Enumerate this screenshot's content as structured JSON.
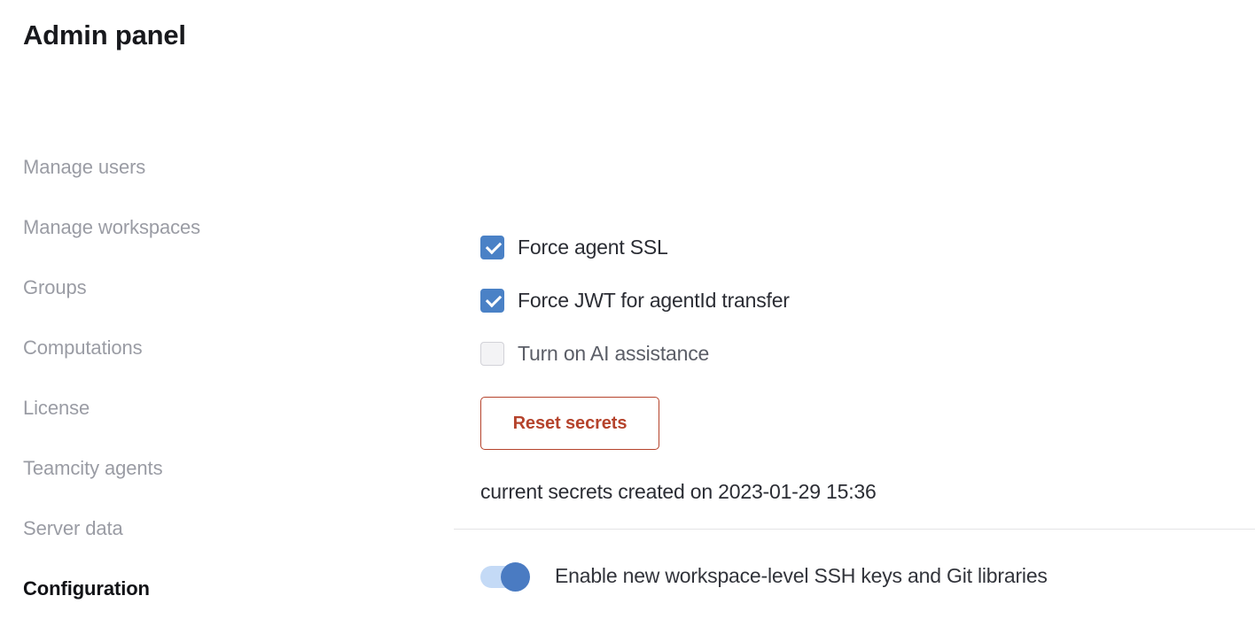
{
  "header": {
    "title": "Admin panel"
  },
  "sidebar": {
    "items": [
      {
        "label": "Manage users",
        "active": false
      },
      {
        "label": "Manage workspaces",
        "active": false
      },
      {
        "label": "Groups",
        "active": false
      },
      {
        "label": "Computations",
        "active": false
      },
      {
        "label": "License",
        "active": false
      },
      {
        "label": "Teamcity agents",
        "active": false
      },
      {
        "label": "Server data",
        "active": false
      },
      {
        "label": "Configuration",
        "active": true
      }
    ]
  },
  "main": {
    "checkboxes": [
      {
        "label": "Force agent SSL",
        "checked": true
      },
      {
        "label": "Force JWT for agentId transfer",
        "checked": true
      },
      {
        "label": "Turn on AI assistance",
        "checked": false
      }
    ],
    "reset_button": {
      "label": "Reset secrets",
      "color": "#b5432c"
    },
    "secrets_note": "current secrets created on 2023-01-29 15:36",
    "toggle": {
      "label": "Enable new workspace-level SSH keys and Git libraries",
      "state": "on",
      "track_color": "#c4daf6",
      "knob_color": "#4a7bc2"
    }
  },
  "colors": {
    "checkbox_accent": "#4a81c6",
    "sidebar_inactive": "#9a9ca4",
    "sidebar_active": "#111216",
    "divider": "#e4e4e6"
  }
}
